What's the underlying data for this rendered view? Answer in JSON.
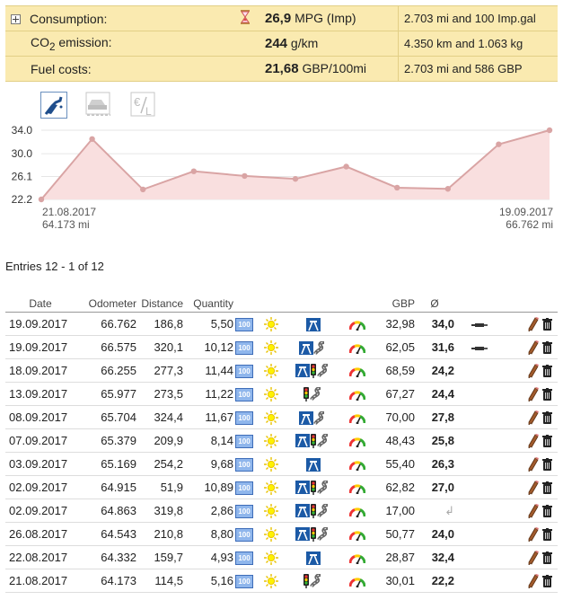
{
  "summary": [
    {
      "label": "Consumption:",
      "value": "26,9",
      "unit": "MPG (Imp)",
      "extra": "2.703 mi and 100 Imp.gal"
    },
    {
      "label_prefix": "CO",
      "label_sub": "2",
      "label_suffix": " emission:",
      "value": "244",
      "unit": "g/km",
      "extra": "4.350 km and 1.063 kg"
    },
    {
      "label": "Fuel costs:",
      "value": "21,68",
      "unit": "GBP/100mi",
      "extra": "2.703 mi and 586 GBP"
    }
  ],
  "chart_icons": [
    "fuel-pump-icon",
    "car-road-icon",
    "euro-per-liter-icon"
  ],
  "chart_data": {
    "type": "area",
    "series": [
      {
        "values": [
          22.2,
          32.5,
          23.9,
          27.0,
          26.2,
          25.7,
          27.8,
          24.2,
          24.0,
          31.6,
          34.0
        ]
      }
    ],
    "ylim": [
      22.2,
      34.0
    ],
    "yticks": [
      "34.0",
      "30.0",
      "26.1",
      "22.2"
    ],
    "x_start": {
      "date": "21.08.2017",
      "odo": "64.173 mi"
    },
    "x_end": {
      "date": "19.09.2017",
      "odo": "66.762 mi"
    },
    "fill_color": "#f9dfdf",
    "line_color": "#d9a4a4",
    "grid": true
  },
  "entries_count": "Entries 12 - 1 of 12",
  "table": {
    "headers": {
      "date": "Date",
      "odometer": "Odometer",
      "distance": "Distance",
      "quantity": "Quantity",
      "currency": "GBP",
      "avg": "Ø"
    },
    "rows": [
      {
        "date": "19.09.2017",
        "odo": "66.762",
        "dist": "186,8",
        "qty": "5,50",
        "road": [
          "motorway"
        ],
        "cost": "32,98",
        "avg": "34,0",
        "note": true
      },
      {
        "date": "19.09.2017",
        "odo": "66.575",
        "dist": "320,1",
        "qty": "10,12",
        "road": [
          "motorway",
          "country"
        ],
        "cost": "62,05",
        "avg": "31,6",
        "note": true
      },
      {
        "date": "18.09.2017",
        "odo": "66.255",
        "dist": "277,3",
        "qty": "11,44",
        "road": [
          "motorway",
          "city",
          "country"
        ],
        "cost": "68,59",
        "avg": "24,2",
        "note": false
      },
      {
        "date": "13.09.2017",
        "odo": "65.977",
        "dist": "273,5",
        "qty": "11,22",
        "road": [
          "city",
          "country"
        ],
        "cost": "67,27",
        "avg": "24,4",
        "note": false
      },
      {
        "date": "08.09.2017",
        "odo": "65.704",
        "dist": "324,4",
        "qty": "11,67",
        "road": [
          "motorway",
          "country"
        ],
        "cost": "70,00",
        "avg": "27,8",
        "note": false
      },
      {
        "date": "07.09.2017",
        "odo": "65.379",
        "dist": "209,9",
        "qty": "8,14",
        "road": [
          "motorway",
          "city",
          "country"
        ],
        "cost": "48,43",
        "avg": "25,8",
        "note": false
      },
      {
        "date": "03.09.2017",
        "odo": "65.169",
        "dist": "254,2",
        "qty": "9,68",
        "road": [
          "motorway"
        ],
        "cost": "55,40",
        "avg": "26,3",
        "note": false
      },
      {
        "date": "02.09.2017",
        "odo": "64.915",
        "dist": "51,9",
        "qty": "10,89",
        "road": [
          "motorway",
          "city",
          "country"
        ],
        "cost": "62,82",
        "avg": "27,0",
        "note": false
      },
      {
        "date": "02.09.2017",
        "odo": "64.863",
        "dist": "319,8",
        "qty": "2,86",
        "road": [
          "motorway",
          "city",
          "country"
        ],
        "cost": "17,00",
        "avg": "↲",
        "note": false
      },
      {
        "date": "26.08.2017",
        "odo": "64.543",
        "dist": "210,8",
        "qty": "8,80",
        "road": [
          "motorway",
          "city",
          "country"
        ],
        "cost": "50,77",
        "avg": "24,0",
        "note": false
      },
      {
        "date": "22.08.2017",
        "odo": "64.332",
        "dist": "159,7",
        "qty": "4,93",
        "road": [
          "motorway"
        ],
        "cost": "28,87",
        "avg": "32,4",
        "note": false
      },
      {
        "date": "21.08.2017",
        "odo": "64.173",
        "dist": "114,5",
        "qty": "5,16",
        "road": [
          "city",
          "country"
        ],
        "cost": "30,01",
        "avg": "22,2",
        "note": false
      }
    ],
    "fuel_badge": "100",
    "row_icons": [
      "fuel-type-100-icon",
      "sun-icon",
      "gauge-icon",
      "pencil-edit-icon",
      "trash-icon"
    ]
  },
  "colors": {
    "summary_bg": "#faeab0",
    "summary_border": "#e2cf86",
    "chart_fill": "#f9dfdf",
    "chart_line": "#d9a4a4"
  }
}
